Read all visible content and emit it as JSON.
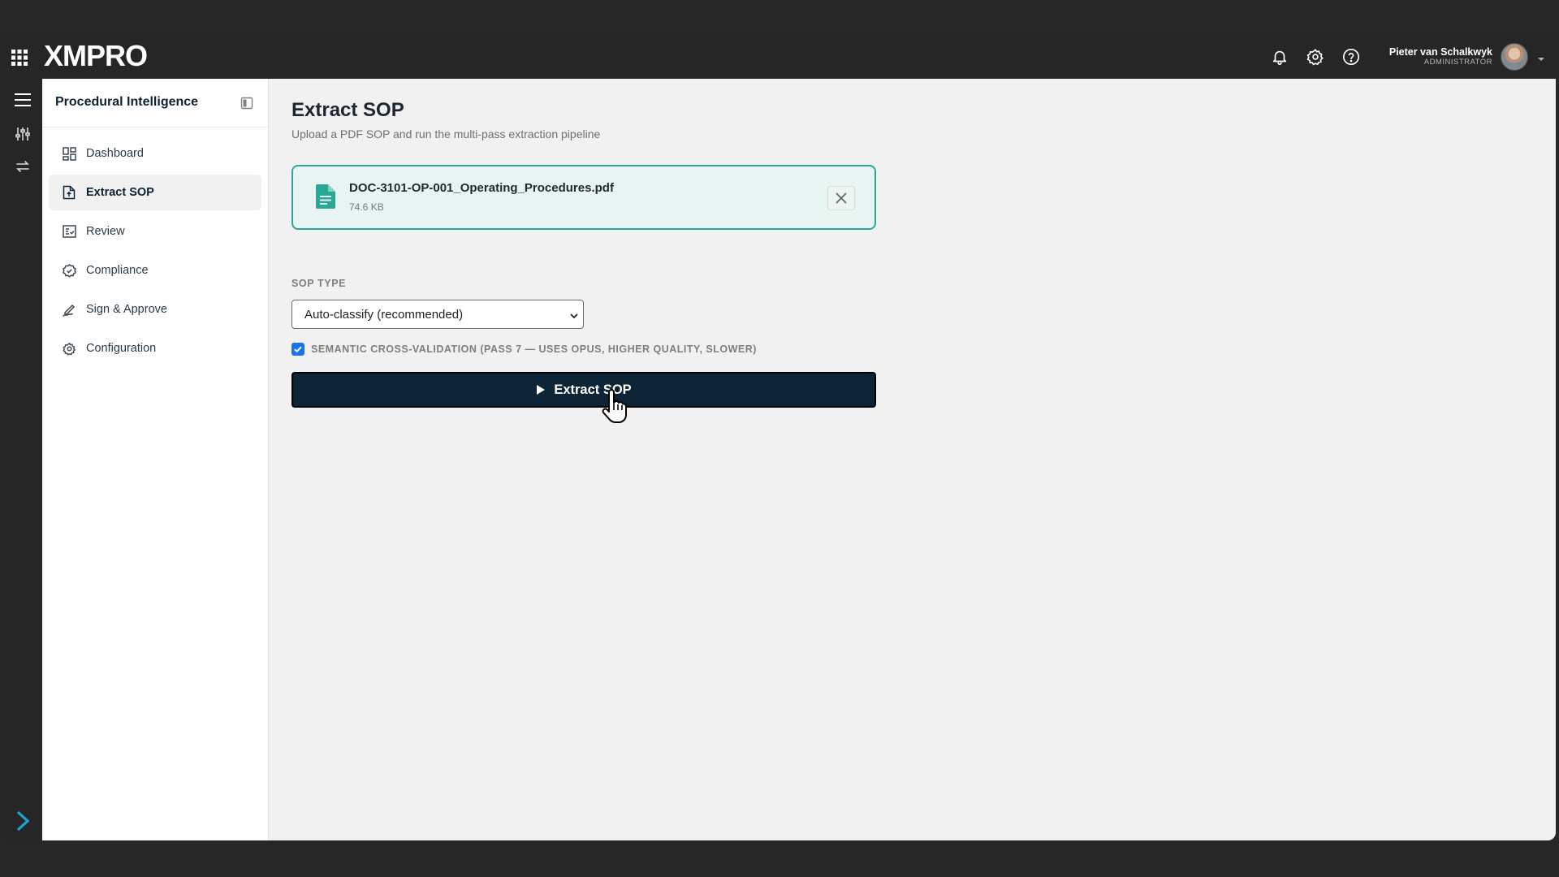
{
  "topbar": {
    "brand": "XMPRO",
    "icons": [
      "apps-grid-icon",
      "bell-icon",
      "gear-icon",
      "help-icon",
      "chevron-down-icon"
    ],
    "user": {
      "name": "Pieter van Schalkwyk",
      "role": "ADMINISTRATOR"
    }
  },
  "rail": {
    "icons": [
      "menu-icon",
      "sliders-icon",
      "swap-icon",
      "expand-icon"
    ]
  },
  "sidebar": {
    "title": "Procedural Intelligence",
    "items": [
      {
        "label": "Dashboard",
        "icon": "dashboard-icon",
        "active": false
      },
      {
        "label": "Extract SOP",
        "icon": "file-upload-icon",
        "active": true
      },
      {
        "label": "Review",
        "icon": "review-icon",
        "active": false
      },
      {
        "label": "Compliance",
        "icon": "compliance-icon",
        "active": false
      },
      {
        "label": "Sign & Approve",
        "icon": "signature-icon",
        "active": false
      },
      {
        "label": "Configuration",
        "icon": "gear-icon",
        "active": false
      }
    ]
  },
  "main": {
    "title": "Extract SOP",
    "subtitle": "Upload a PDF SOP and run the multi-pass extraction pipeline",
    "file": {
      "name": "DOC-3101-OP-001_Operating_Procedures.pdf",
      "size": "74.6 KB"
    },
    "sop_type": {
      "label": "SOP TYPE",
      "value": "Auto-classify (recommended)"
    },
    "semantic_validation": {
      "checked": true,
      "label": "SEMANTIC CROSS-VALIDATION (PASS 7 — USES OPUS, HIGHER QUALITY, SLOWER)"
    },
    "extract_button": "Extract SOP"
  },
  "colors": {
    "accent_teal": "#2aa896",
    "file_card_bg": "#e7f4f1",
    "primary_button": "#0c2435",
    "checkbox": "#1a73e8",
    "chrome": "#262626"
  }
}
